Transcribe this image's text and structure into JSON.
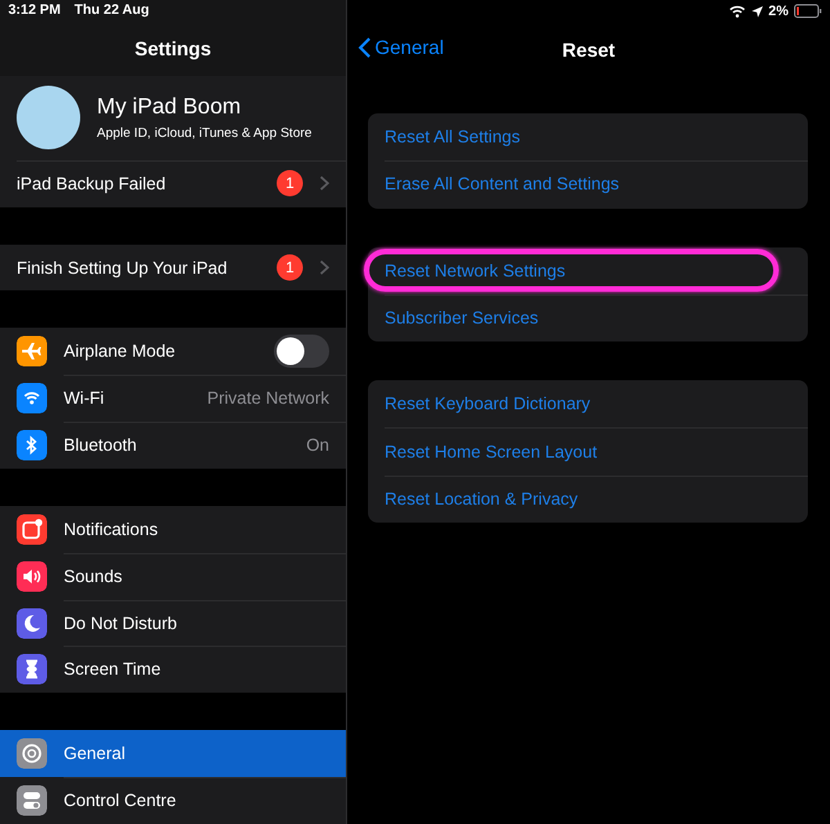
{
  "status_bar": {
    "time": "3:12 PM",
    "date": "Thu 22 Aug",
    "battery": "2%"
  },
  "sidebar": {
    "title": "Settings",
    "profile": {
      "name": "My iPad Boom",
      "subtitle": "Apple ID, iCloud, iTunes & App Store",
      "badge_row": {
        "label": "iPad Backup Failed",
        "badge": "1"
      }
    },
    "groups": [
      {
        "items": [
          {
            "kind": "badge",
            "label": "Finish Setting Up Your iPad",
            "badge": "1",
            "selected": false
          }
        ]
      },
      {
        "items": [
          {
            "kind": "toggle",
            "label": "Airplane Mode",
            "color": "#ff9500",
            "on": false,
            "selected": false
          },
          {
            "kind": "value",
            "label": "Wi-Fi",
            "value": "Private Network",
            "color": "#0a84ff",
            "selected": false
          },
          {
            "kind": "value",
            "label": "Bluetooth",
            "value": "On",
            "color": "#0a84ff",
            "selected": false
          }
        ]
      },
      {
        "items": [
          {
            "kind": "plain",
            "label": "Notifications",
            "color": "#ff3b30",
            "selected": false
          },
          {
            "kind": "plain",
            "label": "Sounds",
            "color": "#ff2d55",
            "selected": false
          },
          {
            "kind": "plain",
            "label": "Do Not Disturb",
            "color": "#5e5ce6",
            "selected": false
          },
          {
            "kind": "plain",
            "label": "Screen Time",
            "color": "#5e5ce6",
            "selected": false
          }
        ]
      },
      {
        "items": [
          {
            "kind": "plain",
            "label": "General",
            "color": "#8e8e93",
            "selected": true
          },
          {
            "kind": "plain",
            "label": "Control Centre",
            "color": "#8e8e93",
            "selected": false
          }
        ]
      }
    ]
  },
  "detail": {
    "back": "General",
    "title": "Reset",
    "groups": [
      {
        "items": [
          {
            "label": "Reset All Settings",
            "highlighted": false
          },
          {
            "label": "Erase All Content and Settings",
            "highlighted": false
          }
        ]
      },
      {
        "items": [
          {
            "label": "Reset Network Settings",
            "highlighted": true
          },
          {
            "label": "Subscriber Services",
            "highlighted": false
          }
        ]
      },
      {
        "items": [
          {
            "label": "Reset Keyboard Dictionary",
            "highlighted": false
          },
          {
            "label": "Reset Home Screen Layout",
            "highlighted": false
          },
          {
            "label": "Reset Location & Privacy",
            "highlighted": false
          }
        ]
      }
    ]
  }
}
